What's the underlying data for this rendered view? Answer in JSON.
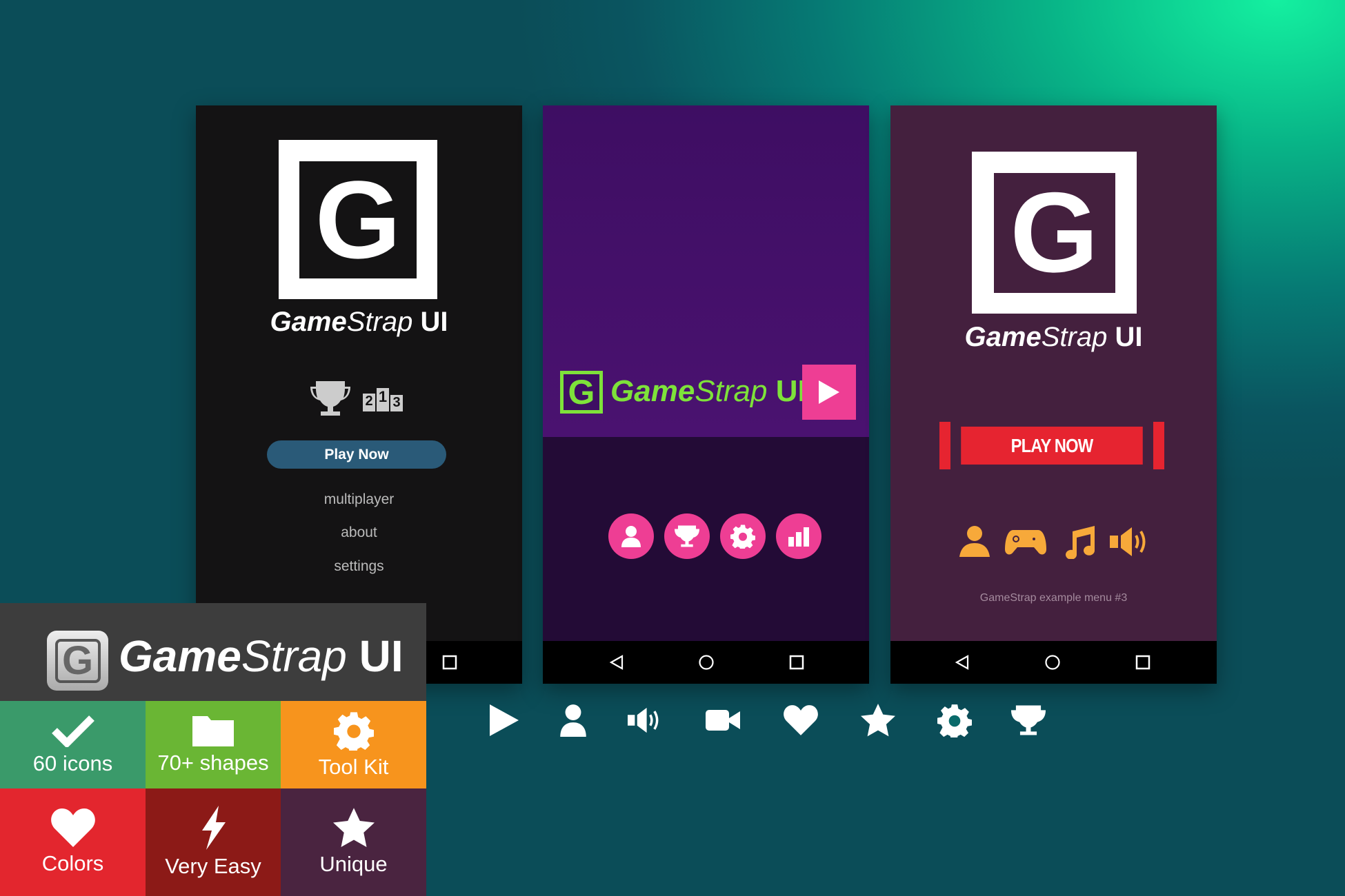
{
  "brand": {
    "game": "Game",
    "strap": "Strap",
    "ui": "UI",
    "logo_letter": "G"
  },
  "phone1": {
    "play_button": "Play Now",
    "podium": [
      "2",
      "1",
      "3"
    ],
    "menu": [
      "multiplayer",
      "about",
      "settings"
    ],
    "bg": "#141314",
    "button_color": "#2a5a78"
  },
  "phone2": {
    "top_bg": "#3e0e63",
    "bottom_bg": "#230b36",
    "accent": "#ee3e94",
    "logo_green": "#7ee23a",
    "icons": [
      "user-icon",
      "trophy-icon",
      "gear-icon",
      "bar-chart-icon"
    ]
  },
  "phone3": {
    "play_button": "PLAY NOW",
    "caption": "GameStrap example menu #3",
    "bg": "#44203e",
    "button_color": "#e62430",
    "icon_color": "#f7a93a",
    "icons": [
      "user-icon",
      "gamepad-icon",
      "music-icon",
      "speaker-icon"
    ]
  },
  "features": [
    {
      "label": "60 icons",
      "icon": "check-icon",
      "color": "#3a9a6a"
    },
    {
      "label": "70+ shapes",
      "icon": "folder-icon",
      "color": "#6ab634"
    },
    {
      "label": "Tool Kit",
      "icon": "gear-icon",
      "color": "#f7941d"
    },
    {
      "label": "Colors",
      "icon": "heart-icon",
      "color": "#e3262e"
    },
    {
      "label": "Very Easy",
      "icon": "lightning-icon",
      "color": "#8c1a17"
    },
    {
      "label": "Unique",
      "icon": "star-icon",
      "color": "#4a2440"
    }
  ],
  "icon_row": [
    "play-icon",
    "user-icon",
    "speaker-icon",
    "video-camera-icon",
    "heart-icon",
    "star-icon",
    "gear-icon",
    "trophy-icon"
  ]
}
